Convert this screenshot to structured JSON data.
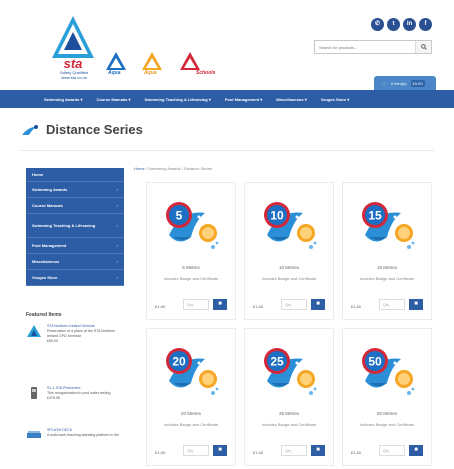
{
  "header": {
    "logo_text": "sta",
    "logo_sub1": "Safety Qualified",
    "logo_sub2": "www.sta.co.uk",
    "sublogos": [
      "Aqua",
      "Aqua",
      "Schools"
    ],
    "social_icons": [
      "phone-icon",
      "twitter-icon",
      "linkedin-icon",
      "facebook-icon"
    ],
    "search_placeholder": "Search for products...",
    "basket_label": "0 item(s)",
    "basket_amount": "£0.00"
  },
  "nav": {
    "items": [
      "Swimming Awards ▾",
      "Course Manuals ▾",
      "Swimming Teaching & Lifesaving ▾",
      "Pool Management ▾",
      "Miscellaneous ▾",
      "Vouges Store ▾"
    ]
  },
  "page": {
    "title": "Distance Series",
    "breadcrumb_home": "Home",
    "breadcrumb_rest": "/ Swimming Awards / Distance Series"
  },
  "sidebar": {
    "items": [
      {
        "label": "Home"
      },
      {
        "label": "Swimming Awards"
      },
      {
        "label": "Course Manuals"
      },
      {
        "label": "Swimming Teaching & Lifesaving"
      },
      {
        "label": "Pool Management"
      },
      {
        "label": "Miscellaneous"
      },
      {
        "label": "Vouges Store"
      }
    ],
    "featured_title": "Featured Items",
    "featured": [
      {
        "title": "STA Northern Ireland Seminar",
        "desc": "Reservation of a place at the STA Northern Ireland CPD Seminar",
        "price": "£65.00"
      },
      {
        "title": "S1-1 STA Photomeer",
        "desc": "This reorganisation in pool water testing",
        "price": "£475.95"
      },
      {
        "title": "SPLASH DECK",
        "desc": "A solid work teaching standing platform in the",
        "price": ""
      }
    ]
  },
  "products": [
    {
      "badge": "5",
      "name": "5 Metres",
      "desc": "Includes Badge and Certificate",
      "price": "£1.40",
      "qty_placeholder": "Qty"
    },
    {
      "badge": "10",
      "name": "10 Metres",
      "desc": "Includes Badge and Certificate",
      "price": "£1.40",
      "qty_placeholder": "Qty"
    },
    {
      "badge": "15",
      "name": "15 Metres",
      "desc": "Includes Badge and Certificate",
      "price": "£1.40",
      "qty_placeholder": "Qty"
    },
    {
      "badge": "20",
      "name": "20 Metres",
      "desc": "Includes Badge and Certificate",
      "price": "£1.40",
      "qty_placeholder": "Qty"
    },
    {
      "badge": "25",
      "name": "25 Metres",
      "desc": "Includes Badge and Certificate",
      "price": "£1.40",
      "qty_placeholder": "Qty"
    },
    {
      "badge": "50",
      "name": "50 Metres",
      "desc": "Includes Badge and Certificate",
      "price": "£1.40",
      "qty_placeholder": "Qty"
    }
  ],
  "colors": {
    "brand_blue": "#2d5ea5",
    "badge_red": "#d3283a",
    "dolphin_blue": "#2a8fd6",
    "sun_orange": "#f5a623"
  }
}
